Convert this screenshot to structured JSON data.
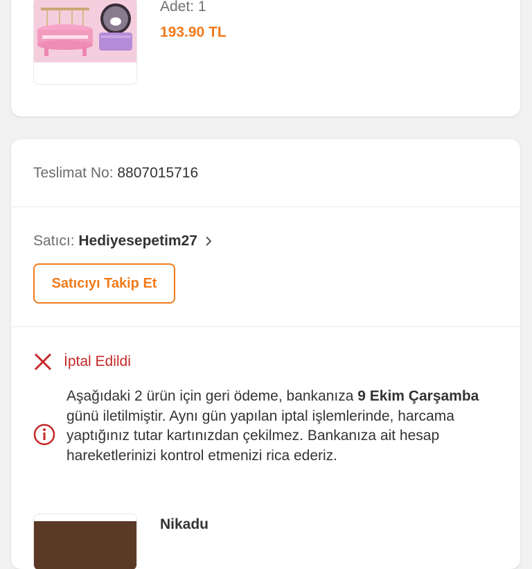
{
  "order_item": {
    "qty_text": "Adet: 1",
    "price": "193.90 TL"
  },
  "delivery": {
    "label": "Teslimat No:",
    "number": "8807015716"
  },
  "seller": {
    "label": "Satıcı:",
    "name": "Hediyesepetim27",
    "follow_label": "Satıcıyı Takip Et"
  },
  "status": {
    "text": "İptal Edildi",
    "icon": "close-x-icon",
    "color": "#c62828"
  },
  "refund_notice": {
    "icon": "info-circle-icon",
    "part1": "Aşağıdaki 2 ürün için geri ödeme, bankanıza ",
    "date": "9 Ekim Çarşamba",
    "part2": " günü iletilmiştir. Aynı gün yapılan iptal işlemlerinde, harcama yaptığınız tutar kartınızdan çekilmez. Bankanıza ait hesap hareketlerinizi kontrol etmenizi rica ederiz."
  },
  "product2": {
    "brand": "Nikadu"
  },
  "colors": {
    "accent": "#f27a1a",
    "danger": "#c62828"
  }
}
